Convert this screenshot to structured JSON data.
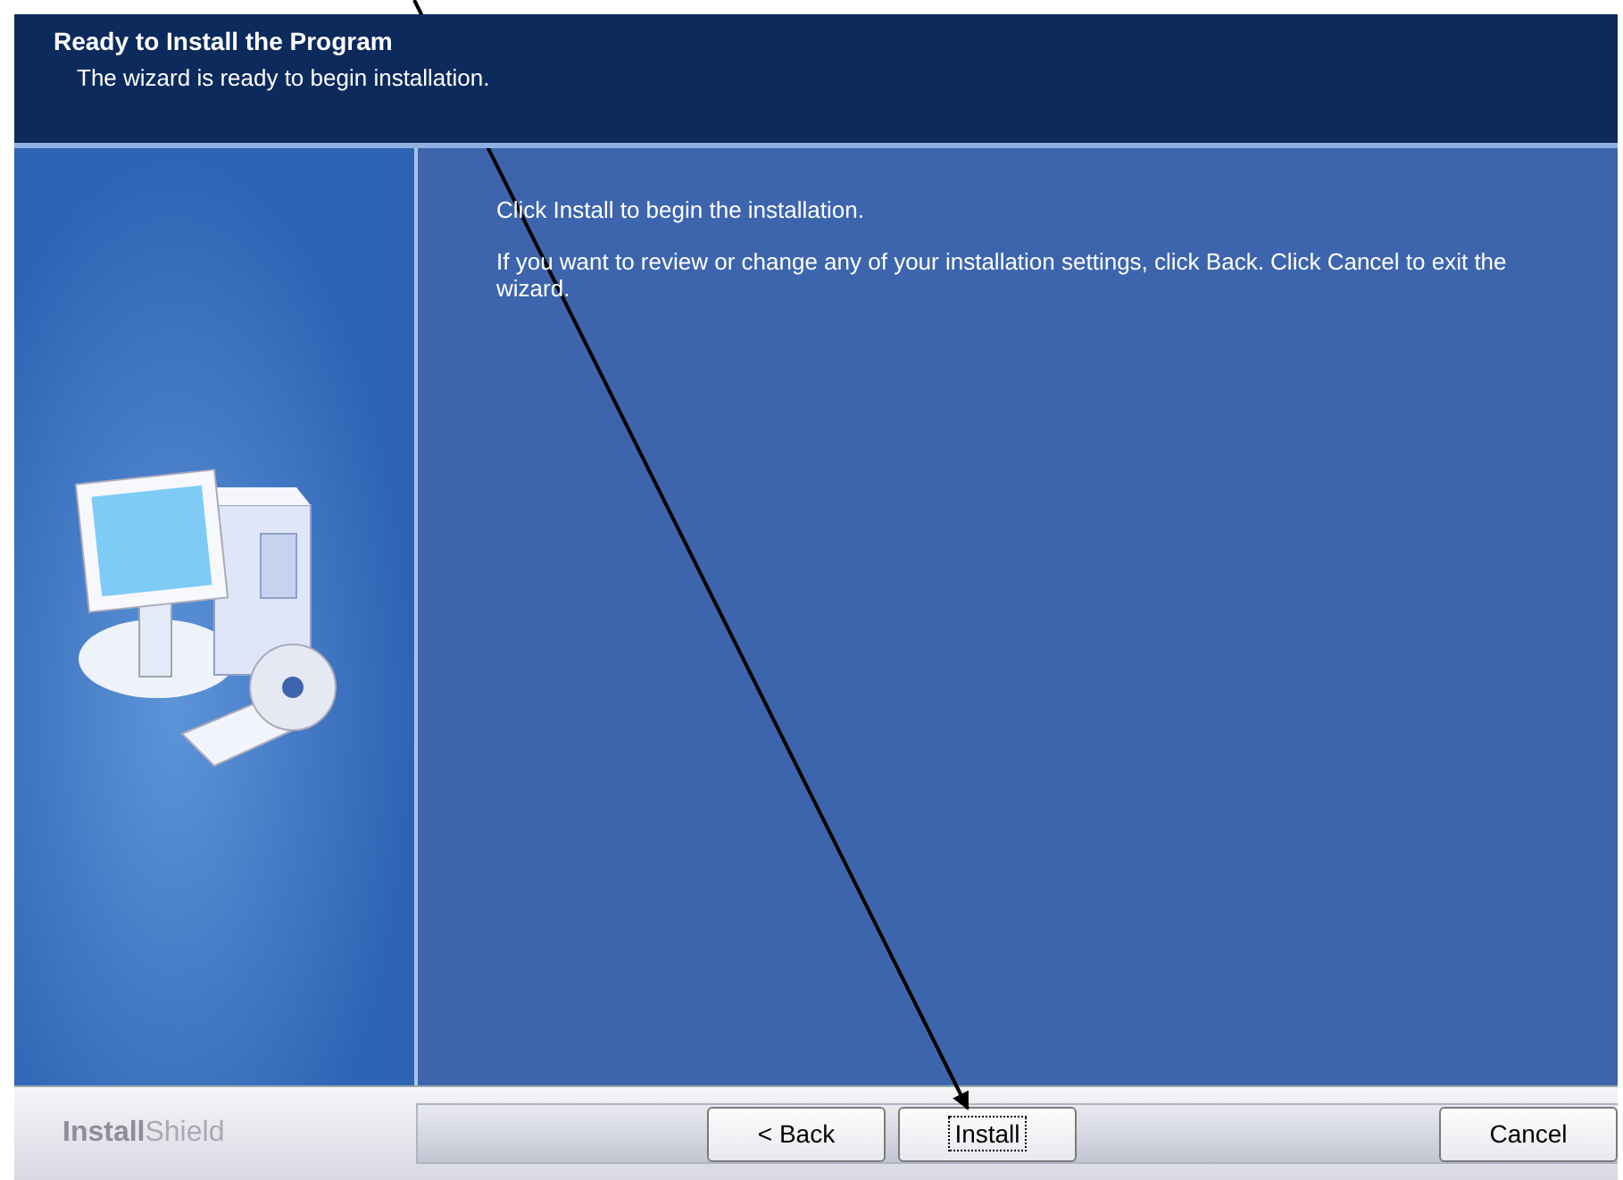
{
  "header": {
    "title": "Ready to Install the Program",
    "subtitle": "The wizard is ready to begin installation."
  },
  "body": {
    "paragraphs": [
      "Click Install to begin the installation.",
      "If you want to review or change any of your installation settings, click Back. Click Cancel to exit the wizard."
    ]
  },
  "footer": {
    "brand": "**Install**Shield",
    "buttons": [
      {
        "label": "< Back",
        "focused": false
      },
      {
        "label": "Install",
        "focused": true
      },
      {
        "label": "Cancel",
        "focused": false
      }
    ]
  }
}
